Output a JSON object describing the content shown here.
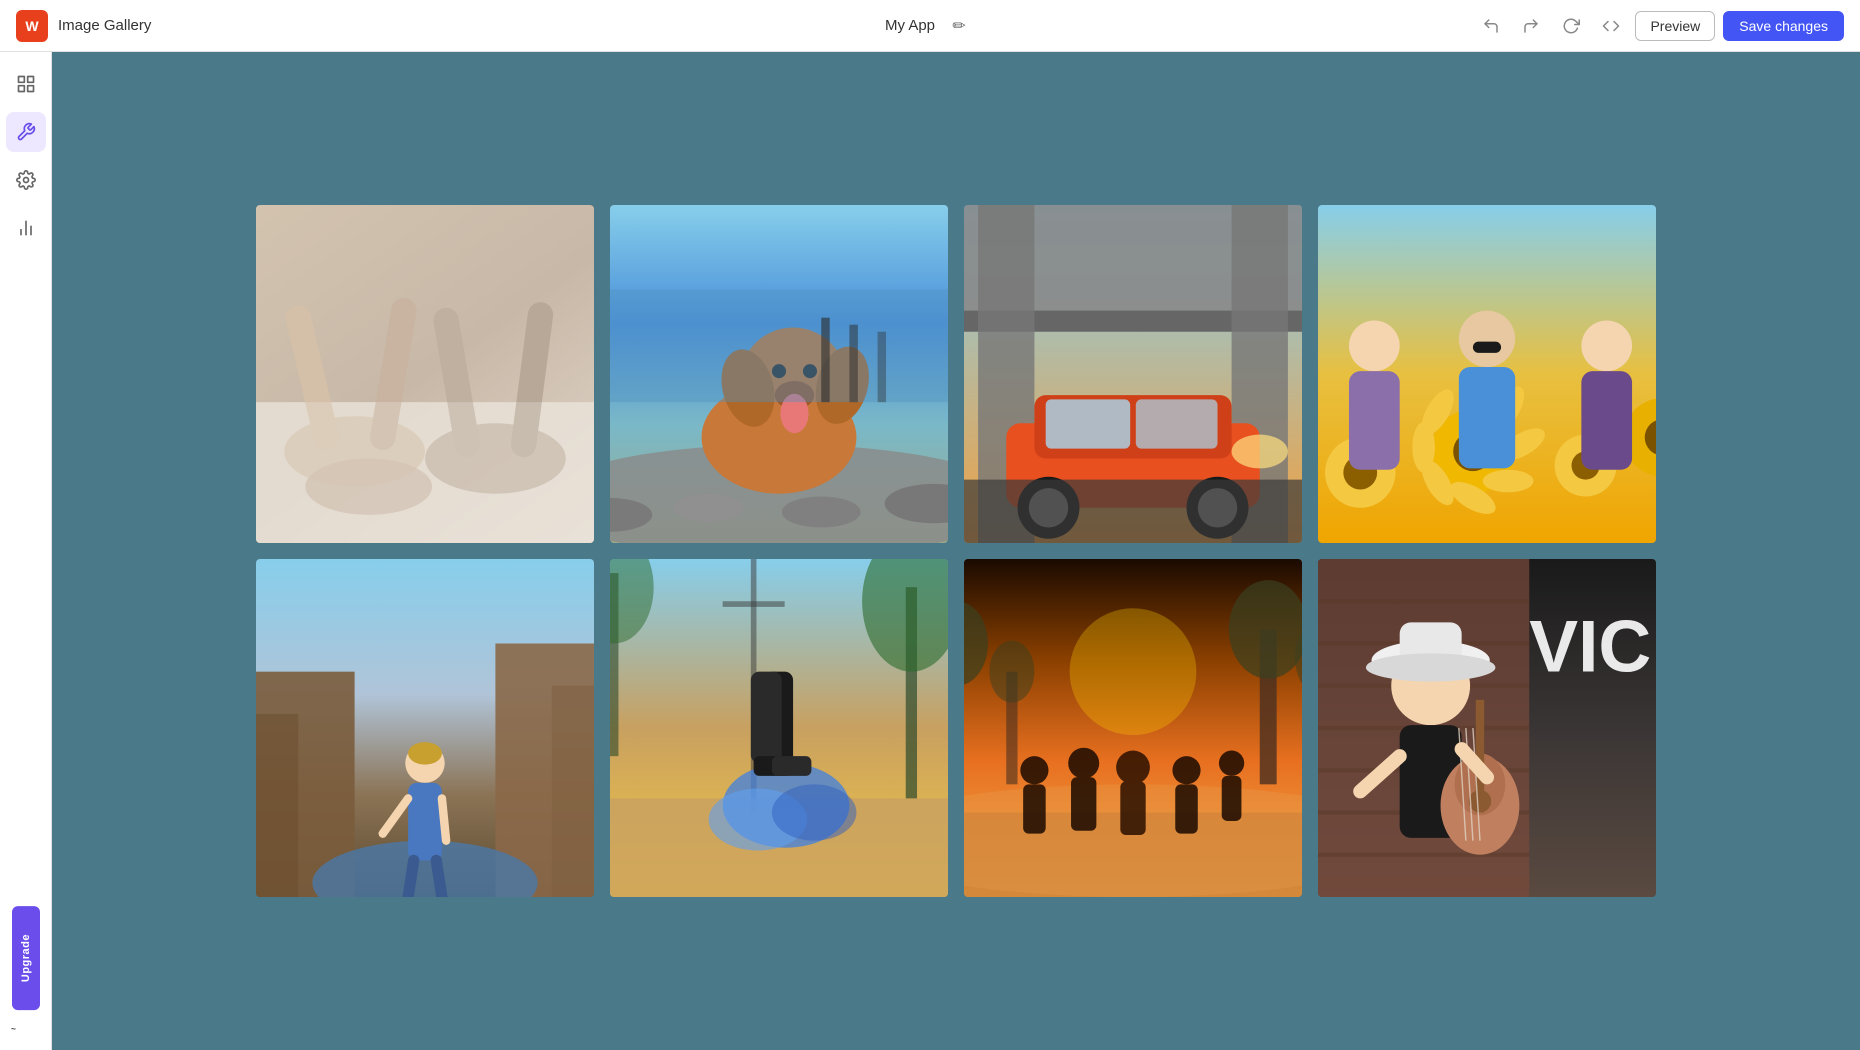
{
  "header": {
    "logo_text": "W",
    "app_name": "Image Gallery",
    "page_title": "My App",
    "edit_icon": "✏️",
    "undo_icon": "↩",
    "redo_icon": "↪",
    "history_icon": "⏱",
    "code_icon": "</>",
    "preview_label": "Preview",
    "save_label": "Save changes"
  },
  "sidebar": {
    "items": [
      {
        "id": "dashboard",
        "icon": "⊞",
        "label": "Dashboard",
        "active": false
      },
      {
        "id": "build",
        "icon": "🔧",
        "label": "Build",
        "active": true
      },
      {
        "id": "settings",
        "icon": "⚙",
        "label": "Settings",
        "active": false
      },
      {
        "id": "analytics",
        "icon": "📊",
        "label": "Analytics",
        "active": false
      }
    ],
    "upgrade_label": "Upgrade",
    "wix_logo": "~"
  },
  "gallery": {
    "images": [
      {
        "id": 1,
        "alt": "Two people lying on floor with legs up",
        "class": "img-1"
      },
      {
        "id": 2,
        "alt": "Golden retriever dog on pebble beach",
        "class": "img-2"
      },
      {
        "id": 3,
        "alt": "Orange sports car under bridge",
        "class": "img-3"
      },
      {
        "id": 4,
        "alt": "Three women laughing in sunflower field",
        "class": "img-4"
      },
      {
        "id": 5,
        "alt": "Woman standing near canyon river",
        "class": "img-5"
      },
      {
        "id": 6,
        "alt": "Person doing parkour jump with blue smoke",
        "class": "img-6"
      },
      {
        "id": 7,
        "alt": "Group of people running in desert at sunset",
        "class": "img-7"
      },
      {
        "id": 8,
        "alt": "Musician playing guitar with white hat",
        "class": "img-8"
      }
    ]
  }
}
